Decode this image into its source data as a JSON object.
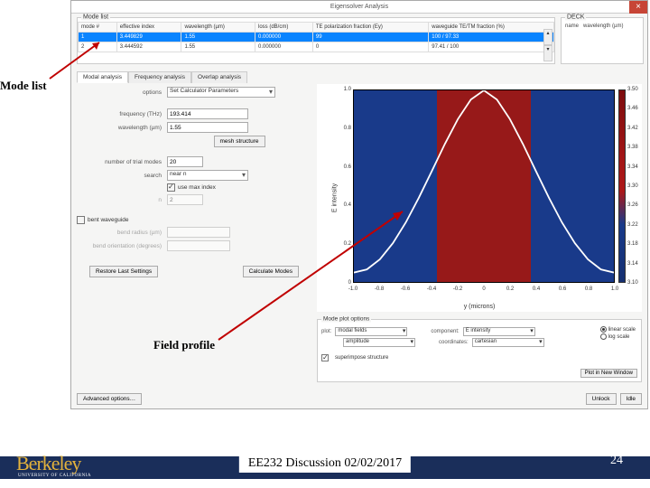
{
  "window": {
    "title": "Eigensolver Analysis",
    "close": "×"
  },
  "deck": {
    "header": "DECK",
    "label_name": "name",
    "label_wl": "wavelength (µm)"
  },
  "mode_list": {
    "header": "Mode list",
    "columns": [
      "mode #",
      "effective index",
      "wavelength (µm)",
      "loss (dB/cm)",
      "TE polarization fraction (Ey)",
      "waveguide TE/TM fraction (%)"
    ],
    "rows": [
      {
        "i": "1",
        "neff": "3.449829",
        "wl": "1.55",
        "loss": "0.000000",
        "te": "99",
        "wg": "100 / 97.33",
        "sel": true
      },
      {
        "i": "2",
        "neff": "3.444592",
        "wl": "1.55",
        "loss": "0.000000",
        "te": "0",
        "wg": "97.41 / 100",
        "sel": false
      }
    ]
  },
  "tabs": {
    "active": "Modal analysis",
    "t1": "Modal analysis",
    "t2": "Frequency analysis",
    "t3": "Overlap analysis"
  },
  "options": {
    "opt_label": "options",
    "opt_val": "Set Calculator Parameters",
    "freq_label": "frequency (THz)",
    "freq_val": "193.414",
    "wl_label": "wavelength (µm)",
    "wl_val": "1.55",
    "mesh_btn": "mesh structure",
    "trial_label": "number of trial modes",
    "trial_val": "20",
    "search_label": "search",
    "search_val": "near n",
    "usemax_label": "use max index",
    "n_label": "n",
    "n_val": "2",
    "bent_label": "bent waveguide",
    "bendrad_label": "bend radius (µm)",
    "bendori_label": "bend orientation (degrees)",
    "restore_btn": "Restore Last Settings",
    "calc_btn": "Calculate Modes"
  },
  "chart_data": {
    "type": "line",
    "title": "",
    "xlabel": "y (microns)",
    "ylabel": "E intensity",
    "xlim": [
      -1.0,
      1.0
    ],
    "ylim": [
      0,
      1.0
    ],
    "xticks": [
      "-1.0",
      "-0.8",
      "-0.6",
      "-0.4",
      "-0.2",
      "0",
      "0.2",
      "0.4",
      "0.6",
      "0.8",
      "1.0"
    ],
    "yticks": [
      "0",
      "0.2",
      "0.4",
      "0.6",
      "0.8",
      "1.0"
    ],
    "series": [
      {
        "name": "E intensity",
        "x": [
          -1.0,
          -0.8,
          -0.6,
          -0.4,
          -0.2,
          0,
          0.2,
          0.4,
          0.6,
          0.8,
          1.0
        ],
        "values": [
          0.05,
          0.12,
          0.3,
          0.58,
          0.86,
          1.0,
          0.86,
          0.58,
          0.3,
          0.12,
          0.05
        ]
      }
    ],
    "colorbar_ticks": [
      "3.50",
      "3.46",
      "3.42",
      "3.38",
      "3.34",
      "3.30",
      "3.26",
      "3.22",
      "3.18",
      "3.14",
      "3.10"
    ],
    "region_red_yrange": [
      -0.36,
      0.36
    ]
  },
  "plotopts": {
    "header": "Mode plot options",
    "plot_label": "plot:",
    "plot_val": "modal fields",
    "comp_label": "component:",
    "comp_val": "E intensity",
    "amp_val": "amplitude",
    "coord_label": "coordinates:",
    "coord_val": "cartesian",
    "superimpose": "superimpose structure",
    "linear": "linear scale",
    "log": "log scale",
    "newwin": "Plot in New Window"
  },
  "bottom": {
    "advanced": "Advanced options…",
    "unlock": "Unlock",
    "idle": "Idle"
  },
  "ann": {
    "modelist": "Mode list",
    "field": "Field profile"
  },
  "footer": {
    "logo": "Berkeley",
    "logosub": "UNIVERSITY OF CALIFORNIA",
    "text": "EE232 Discussion 02/02/2017",
    "page": "24"
  }
}
